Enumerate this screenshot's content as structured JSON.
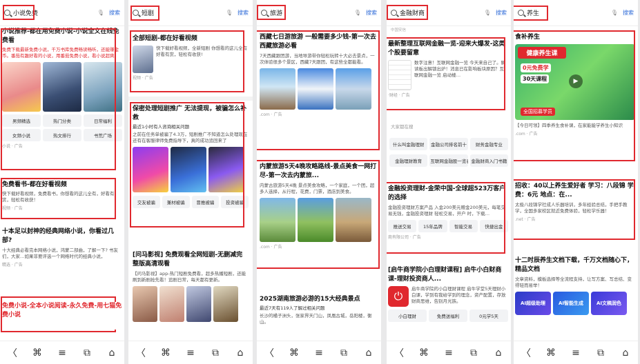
{
  "queries": [
    "小说免费",
    "短剧",
    "旅游",
    "金融财商",
    "养生"
  ],
  "search_label": "搜索",
  "nav": [
    "〈",
    "⌘",
    "≡",
    "⧉",
    "⌂"
  ],
  "p1": {
    "c1_title": "小说推荐-都在用免费小说-小说全文在线免费看",
    "c1_txt": "免费下载最新免费小说，千万书库免费畅读畅听，还能赚金币。番茄有趣好看的小说，用番茄免费小说，看小说超爽。",
    "pills": [
      "男频精选",
      "热门分类",
      "日常福利",
      "女频小说",
      "热文排行",
      "书荒广场"
    ],
    "c1_src": "小说 · 广告",
    "c2_title": "免费看书-都在好看视频",
    "c2_txt": "快下载好看视频，免费看书，你想看的这儿全有，好看有赏，轻松有收获！",
    "c2_src": "视频 · 广告",
    "c3_title": "十本足以封神的经典网络小说，你看过几部?",
    "c3_txt": "十大经典必看完本网络小说，鸿蒙二部曲，了解一下? 书友们，大家…如果非要评选一个网络时代的经典小说，",
    "c3_src": "精选 · 广告",
    "c4_title": "免费小说-全本小说阅读-永久免费-用七猫免费小说"
  },
  "p2": {
    "c1_title": "全部短剧-都在好看视频",
    "c1_txt": "快下载好看视频，全新短剧 你想看的这儿全有好看有赏，轻松有收获!",
    "c1_src": "视频 · 广告",
    "c2_title": "保密处理短剧推广 无法提现，被骗怎么补救",
    "c2_badge": "最近1小时有人咨询相关问题",
    "c2_txt": "之前在任务单被骗了4.3万，短剧推广不知道怎么处理现在还有在客服律师免费指导下，真的成功追回来了",
    "pills": [
      "交友被骗",
      "兼材被骗",
      "冒推被骗",
      "投资被骗"
    ],
    "c3_title": "[问马影视] 免费观看全网短剧-无删减完整版高清观看",
    "c3_txt": "【问马影视】app-热门短剧免费看，超多热播短剧，还能刷到新剧抢先看！追剧日常，每天都有更新。"
  },
  "p3": {
    "c1_title": "西藏七日游旅游 一般需要多少钱-第一次去西藏旅游必看",
    "c1_txt": "7天西藏跟团游，当地导游带你轻松玩转十大必去景点，一次体验很多个景区，西藏7天跟团，有这些全都能看。",
    "c1_src": ".com · 广告",
    "c2_title": "内蒙旅游5天4晚攻略路线-景点美食一网打尽-第一次去内蒙旅...",
    "c2_txt": "内蒙古旅游5天4晚 景点美食攻略，一个家庭，一个团，超多人选择，从行程，花费，门票，酒店到美食。",
    "c2_src": ".com · 广告",
    "c3_title": "2025湖南旅游必游的15大经典景点",
    "c3_badge": "最近7天有119人了解过相关问题",
    "c3_txt": "长沙的橘子洲头，张家界天门山，凤凰古城，岳阳楼，衡山。"
  },
  "p4": {
    "top_src": "中国安信",
    "c1_title": "最新整理互联网金融一览-迎来大爆发-这类个股要留意",
    "c1_txt": "数字注意！互联网金融一览 今天来自己了。解读板出解锁出炉！消息已在影响板块原因？互联网金融一览 启动楼…",
    "c1_src": "·财经 · 广告",
    "hot_label": "大家都在搜",
    "pills": [
      "什么叫金融理财",
      "金融公司排名前十",
      "财务金融专业",
      "金融理财教育",
      "互联网金融股一览表",
      "金融财商入门书籍"
    ],
    "c2_title": "金融投资理财-金荣中国-全球超523万客户的选择",
    "c2_txt": "金融投资理财方案产品 入金200美元赠金200美元，每笔交易无钱，金融投资理财 轻松交易，开户 时，下载…",
    "pills2": [
      "推送交易",
      "15年品牌",
      "智能交易",
      "快捷出金"
    ],
    "c2_src": "商有限公司 · 广告",
    "c3_title": "[启牛商学院小白理财课程] 启牛小白财商课-理财投资商人...",
    "c3_txt": "启牛商学院的小白理财课程 启牛学堂5天理财小白课，学到有我给学到的理念，资产配置，存放财商思维，告别月光族。",
    "pills3": [
      "小白理财",
      "免费送福利",
      "0元学5天"
    ]
  },
  "p5": {
    "c1_title": "食补养生",
    "c1_img_text": [
      "健康养生课",
      "0元免费学",
      "30天课程",
      "全国招募学员"
    ],
    "c1_txt": "【今日可领】四季养生食补课，在家能能学养生小知识",
    "c1_src": ".com · 广告",
    "c2_title": "招收：40以上养生爱好者 学习：八段锦 学费：6元 地点：在...",
    "c2_txt": "太极八段锦学社成人乐器培训，多年经验总结，手把手教学，全国多家校区就近免费体验，轻松学乐器！",
    "c2_src": ".net · 广告",
    "c3_title": "十二时辰养生文档下载，千万文档随心下，精品文档",
    "c3_txt": "文章资料，模板选择等全流程支持，让写方案、写总结、变得轻而易举！",
    "ai": [
      "AI超级助理",
      "AI智能生成",
      "AI文稿润色"
    ]
  }
}
